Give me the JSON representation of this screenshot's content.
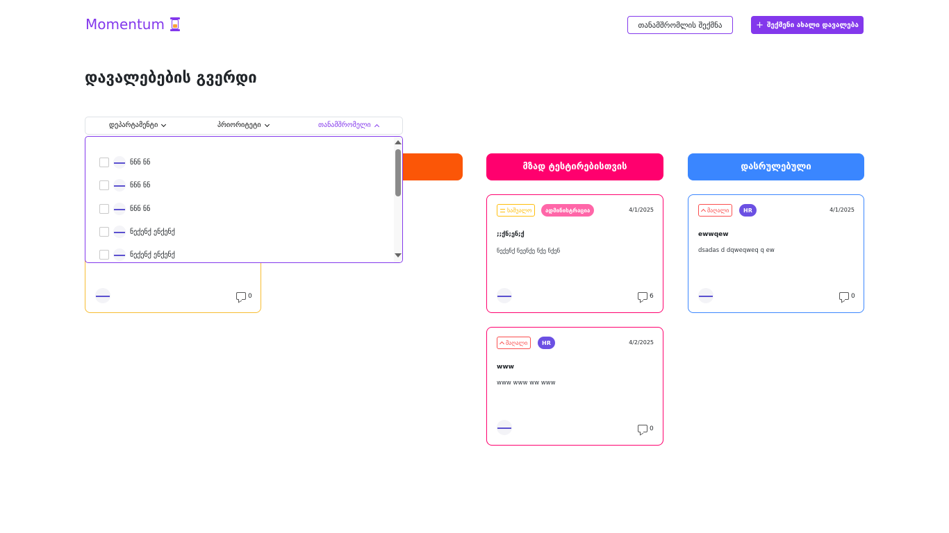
{
  "header": {
    "logo_text": "Momentum",
    "logo_icon": "hourglass-icon",
    "create_employee_label": "თანამშრომლის შექმნა",
    "create_task_label": "შექმენი ახალი დავალება"
  },
  "page_title": "დავალებების გვერდი",
  "filters": {
    "department_label": "დეპარტამენტი",
    "priority_label": "პრიორიტეტი",
    "employee_label": "თანამშრომელი",
    "active": "employee"
  },
  "employee_dropdown": {
    "items": [
      {
        "name": "ნნნ ნნ",
        "checked": false
      },
      {
        "name": "ნნნ ნნ",
        "checked": false
      },
      {
        "name": "ნნნ ნნ",
        "checked": false
      },
      {
        "name": "ნექენქ ენქენქ",
        "checked": false
      },
      {
        "name": "ნექენქ ენქენქ",
        "checked": false
      }
    ]
  },
  "columns": [
    {
      "title": "",
      "color": "#fb5607"
    },
    {
      "title": "",
      "color": "#fb5607"
    },
    {
      "title": "მზად ტესტირებისთვის",
      "color": "#ff006e"
    },
    {
      "title": "დასრულებული",
      "color": "#3a86ff"
    }
  ],
  "cards": {
    "col1_card1": {
      "comments": "0",
      "border_color": "#f7bc30"
    },
    "ready_card1": {
      "priority": "საშუალო",
      "priority_color": "#ffbe0b",
      "department": "ადმინისტრაცია",
      "department_color": "#ff66a8",
      "date": "4/1/2025",
      "title": ";;ქნ;ენ;ქ",
      "description": "ნექენქ ნეენქე ნქე ნქენ",
      "comments": "6",
      "border_color": "#ff006e"
    },
    "ready_card2": {
      "priority": "მაღალი",
      "priority_color": "#fa4d4d",
      "department": "HR",
      "department_color": "#8338ec",
      "date": "4/2/2025",
      "title": "www",
      "description": "www www ww www",
      "comments": "0",
      "border_color": "#ff006e"
    },
    "done_card1": {
      "priority": "მაღალი",
      "priority_color": "#fa4d4d",
      "department": "HR",
      "department_color": "#8338ec",
      "date": "4/1/2025",
      "title": "ewwqew",
      "description": "dsadas d dqweqweq q ew",
      "comments": "0",
      "border_color": "#3a86ff"
    }
  }
}
